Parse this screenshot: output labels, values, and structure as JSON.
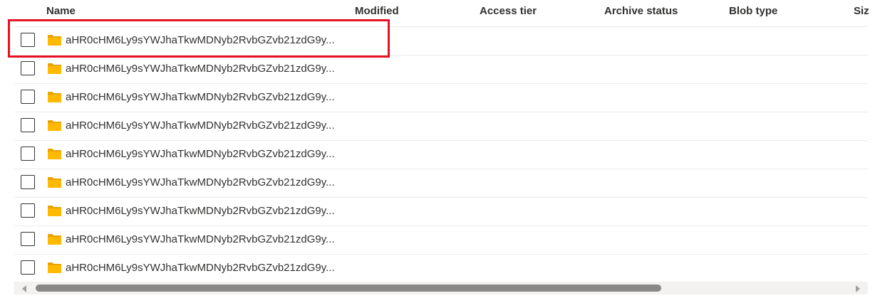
{
  "columns": {
    "name": "Name",
    "modified": "Modified",
    "access_tier": "Access tier",
    "archive_status": "Archive status",
    "blob_type": "Blob type",
    "size": "Siz"
  },
  "rows": [
    {
      "name": "aHR0cHM6Ly9sYWJhaTkwMDNyb2RvbGZvb21zdG9y..."
    },
    {
      "name": "aHR0cHM6Ly9sYWJhaTkwMDNyb2RvbGZvb21zdG9y..."
    },
    {
      "name": "aHR0cHM6Ly9sYWJhaTkwMDNyb2RvbGZvb21zdG9y..."
    },
    {
      "name": "aHR0cHM6Ly9sYWJhaTkwMDNyb2RvbGZvb21zdG9y..."
    },
    {
      "name": "aHR0cHM6Ly9sYWJhaTkwMDNyb2RvbGZvb21zdG9y..."
    },
    {
      "name": "aHR0cHM6Ly9sYWJhaTkwMDNyb2RvbGZvb21zdG9y..."
    },
    {
      "name": "aHR0cHM6Ly9sYWJhaTkwMDNyb2RvbGZvb21zdG9y..."
    },
    {
      "name": "aHR0cHM6Ly9sYWJhaTkwMDNyb2RvbGZvb21zdG9y..."
    },
    {
      "name": "aHR0cHM6Ly9sYWJhaTkwMDNyb2RvbGZvb21zdG9y..."
    }
  ],
  "colors": {
    "folder": "#ffb900",
    "highlight": "#e81123",
    "divider": "#edebe9"
  },
  "icons": {
    "row_icon": "folder-icon"
  }
}
